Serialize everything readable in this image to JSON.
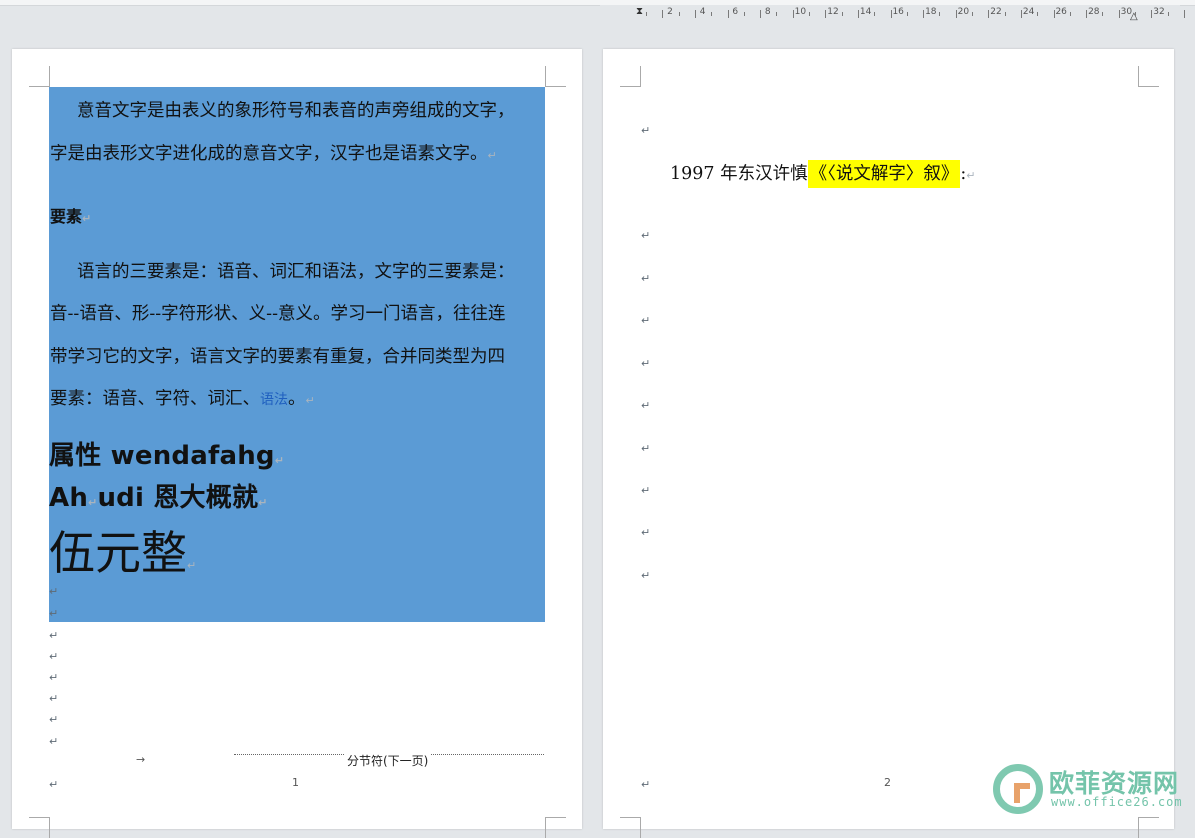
{
  "ruler": {
    "numbers": [
      "2",
      "4",
      "6",
      "8",
      "10",
      "12",
      "14",
      "16",
      "18",
      "20",
      "22",
      "24",
      "26",
      "28",
      "30",
      "32"
    ]
  },
  "page1": {
    "paragraph1_line1": "意音文字是由表义的象形符号和表音的声旁组成的文字，",
    "paragraph1_line2": "字是由表形文字进化成的意音文字，汉字也是语素文字。",
    "heading": "要素",
    "paragraph2_line1": "语言的三要素是：语音、词汇和语法，文字的三要素是：",
    "paragraph2_line2": "音--语音、形--字符形状、义--意义。学习一门语言，往往连",
    "paragraph2_line3": "带学习它的文字，语言文字的要素有重复，合并同类型为四",
    "paragraph2_line4_prefix": "要素：语音、字符、词汇、",
    "paragraph2_line4_link": "语法",
    "paragraph2_line4_suffix": "。",
    "line_bold1": "属性 wendafahg",
    "line_bold2_a": "Ah",
    "line_bold2_b": "udi 恩大概就",
    "line_huge": "伍元整",
    "section_break_label": "分节符(下一页)",
    "page_number": "1"
  },
  "page2": {
    "line_prefix": "1997 年东汉许慎",
    "line_highlight": "《〈说文解字〉叙》",
    "line_suffix": ":",
    "page_number": "2"
  },
  "marks": {
    "paragraph": "↵",
    "tab": "→"
  },
  "watermark": {
    "title": "欧菲资源网",
    "subtitle": "www.office26.com"
  },
  "colors": {
    "selection": "#5b9bd5",
    "highlight": "#ffff00",
    "link": "#1f5fbf"
  }
}
